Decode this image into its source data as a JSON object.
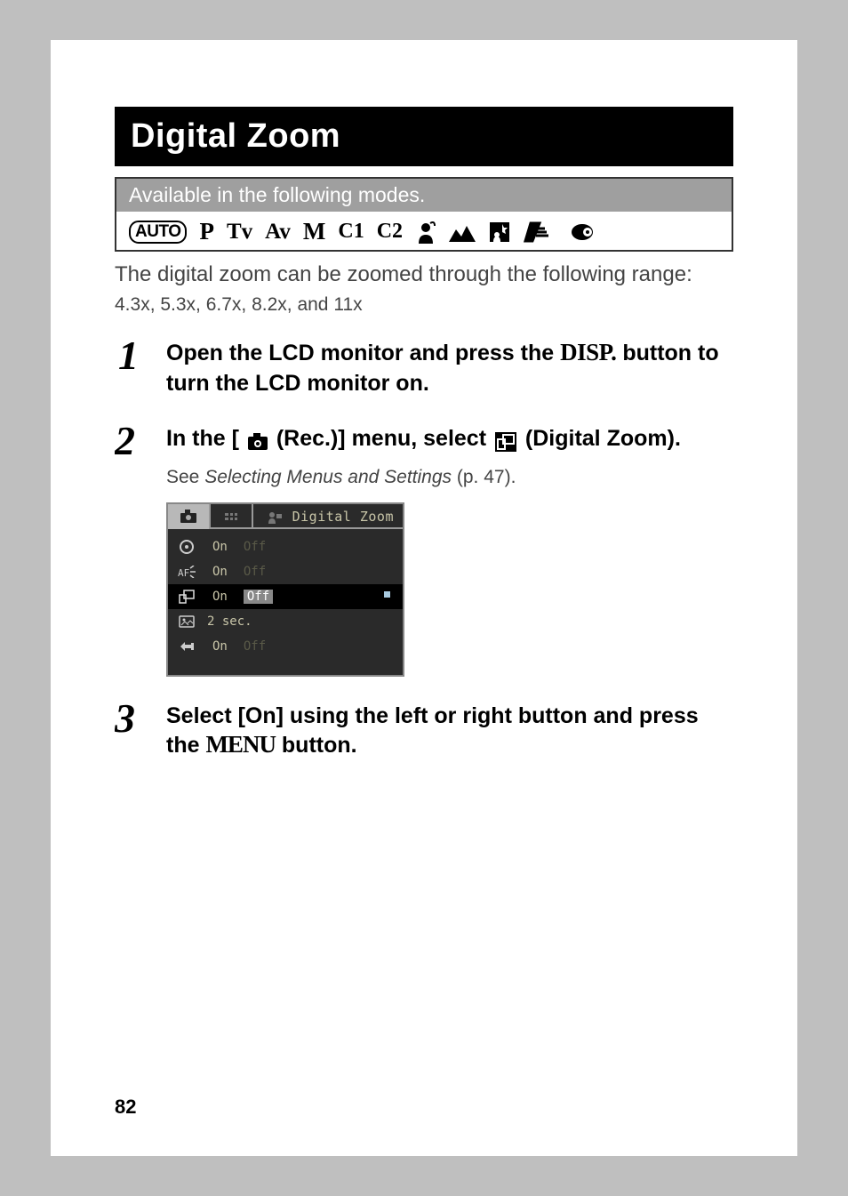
{
  "title": "Digital Zoom",
  "modes_label": "Available in the following modes.",
  "mode_labels": {
    "auto": "AUTO",
    "p": "P",
    "tv": "Tv",
    "av": "Av",
    "m": "M",
    "c1": "C1",
    "c2": "C2"
  },
  "intro": "The digital zoom can be zoomed through the following range:",
  "zoom_range": "4.3x, 5.3x, 6.7x, 8.2x, and 11x",
  "step1": {
    "pre": "Open the LCD monitor and press the ",
    "disp": "DISP.",
    "post": " button to turn the LCD monitor on."
  },
  "step2": {
    "pre": "In the [ ",
    "rec": " (Rec.)] menu, select ",
    "dz": " (Digital Zoom).",
    "see_pre": "See ",
    "see_em": "Selecting Menus and Settings",
    "see_post": " (p. 47)."
  },
  "step3": {
    "pre": "Select [On] using the left or right button and press the ",
    "menu": "MENU",
    "post": " button."
  },
  "screenshot": {
    "title": "Digital Zoom",
    "rows": [
      {
        "on": "On",
        "off": "Off",
        "dim": true
      },
      {
        "on": "On",
        "off": "Off",
        "dim": true
      },
      {
        "on": "On",
        "off": "Off",
        "hl": true
      },
      {
        "text": "2 sec."
      },
      {
        "on": "On",
        "off": "Off",
        "dim": true
      }
    ]
  },
  "page_number": "82"
}
